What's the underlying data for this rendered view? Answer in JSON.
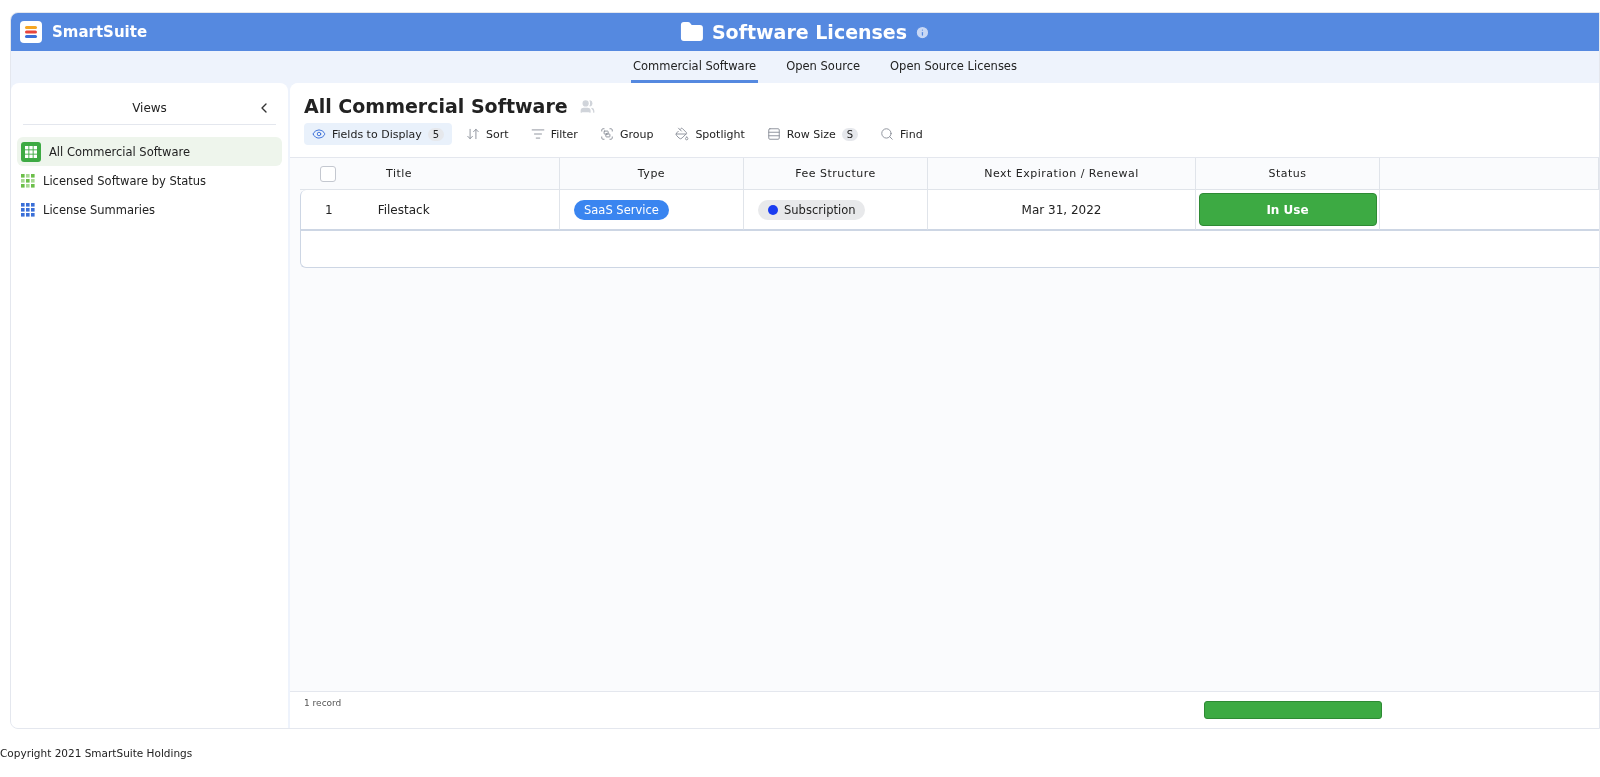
{
  "app": {
    "name": "SmartSuite"
  },
  "header": {
    "title": "Software Licenses"
  },
  "tabs": [
    {
      "label": "Commercial Software",
      "selected": true
    },
    {
      "label": "Open Source",
      "selected": false
    },
    {
      "label": "Open Source Licenses",
      "selected": false
    }
  ],
  "sidebar": {
    "title": "Views",
    "items": [
      {
        "label": "All Commercial Software",
        "kind": "grid",
        "selected": true
      },
      {
        "label": "Licensed Software by Status",
        "kind": "kanban",
        "selected": false
      },
      {
        "label": "License Summaries",
        "kind": "summary",
        "selected": false
      }
    ]
  },
  "view": {
    "title": "All Commercial Software"
  },
  "toolbar": [
    {
      "label": "Fields to Display",
      "kind": "eye",
      "badge": "5",
      "active": true
    },
    {
      "label": "Sort",
      "kind": "sort",
      "active": false
    },
    {
      "label": "Filter",
      "kind": "filter",
      "active": false
    },
    {
      "label": "Group",
      "kind": "group",
      "active": false
    },
    {
      "label": "Spotlight",
      "kind": "spotlight",
      "active": false
    },
    {
      "label": "Row Size",
      "kind": "rowsize",
      "badge": "S",
      "active": false
    },
    {
      "label": "Find",
      "kind": "find",
      "active": false
    }
  ],
  "table": {
    "select_all": {
      "checked": false
    },
    "columns": [
      "Title",
      "Type",
      "Fee Structure",
      "Next Expiration / Renewal",
      "Status"
    ],
    "rows": [
      {
        "number": "1",
        "title": "Filestack",
        "type": "SaaS Service",
        "fee": {
          "label": "Subscription",
          "color": "#1a3cf0"
        },
        "date": "Mar 31, 2022",
        "status": {
          "label": "In Use",
          "color": "#3daa43"
        }
      }
    ]
  },
  "footer": {
    "count": "1 record"
  },
  "copyright": "Copyright 2021 SmartSuite Holdings"
}
